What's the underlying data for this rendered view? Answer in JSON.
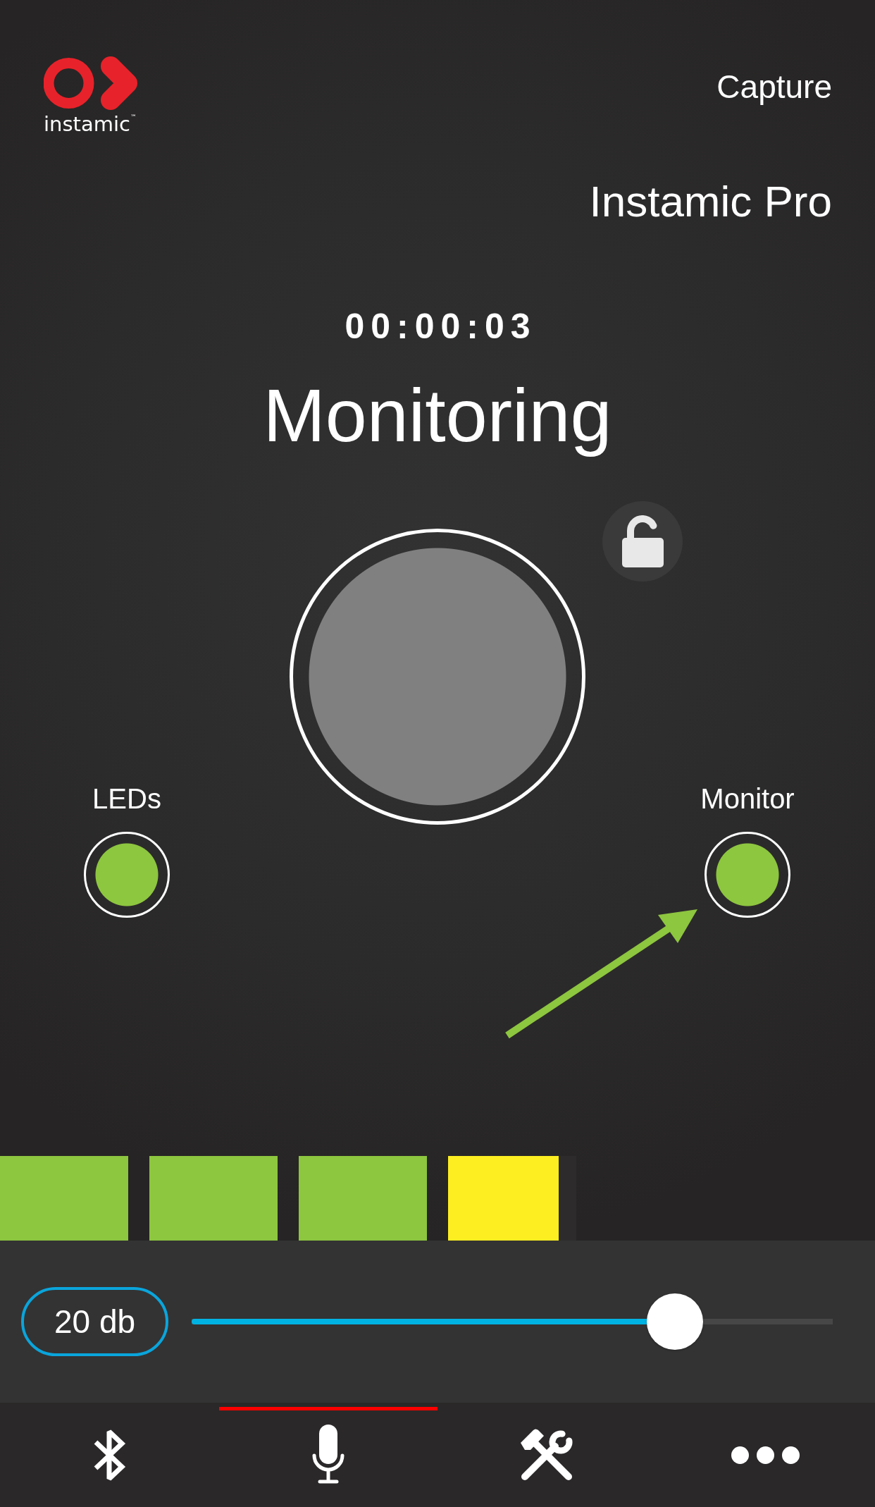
{
  "header": {
    "logo": {
      "wordmark": "instamic$^{™}$"
    },
    "mode": "Capture",
    "device": "Instamic Pro"
  },
  "timer": "00:00:03",
  "status": "Monitoring",
  "lock": {
    "locked": false
  },
  "record_button": {
    "recording": false
  },
  "toggles": [
    {
      "label": "LEDs",
      "on": true
    },
    {
      "label": "Monitor",
      "on": true
    }
  ],
  "level_meter": {
    "segments": [
      {
        "color": "#8dc63f"
      },
      {
        "color": "#8dc63f"
      },
      {
        "color": "#8dc63f"
      },
      {
        "color": "#fcee21",
        "level": 0.86
      }
    ]
  },
  "gain": {
    "reading": "20 db",
    "level": 0.754
  },
  "nav_tabs": [
    {
      "selected": false
    },
    {
      "selected": true
    },
    {
      "selected": false
    },
    {
      "selected": false
    }
  ]
}
